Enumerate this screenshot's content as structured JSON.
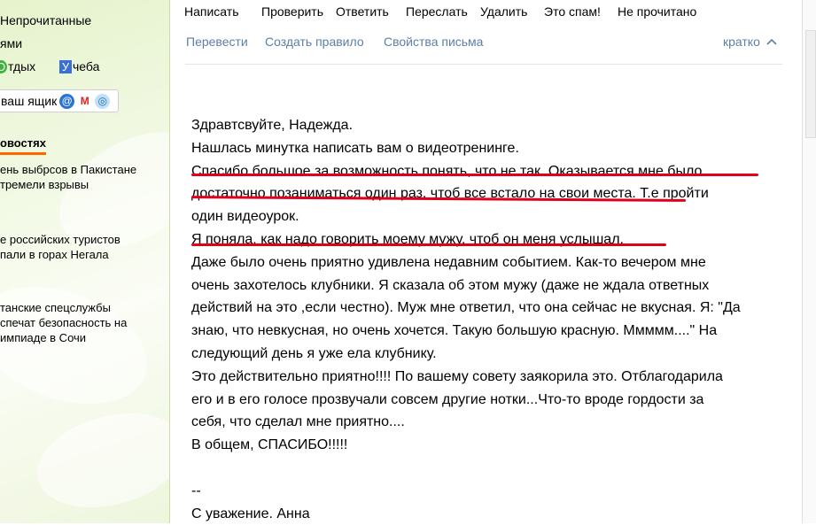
{
  "sidebar": {
    "unread_label": "Непрочитанные",
    "my_label": "ями",
    "tags": [
      {
        "label": "Отдых",
        "color": "#3cb43c"
      },
      {
        "label": "Учеба",
        "color": "#3a6fd8"
      }
    ],
    "mailbox_label": "ваш ящик",
    "news_heading": "овостях",
    "news_items": [
      {
        "line1": "ень выбрсов в Пакистане",
        "line2": "тремели взрывы"
      },
      {
        "line1": "е российских туристов",
        "line2": "пали в горах Негала"
      },
      {
        "line1": "танские спецслужбы",
        "line2": "спечат безопасность на",
        "line3": "импиаде в Сочи"
      }
    ]
  },
  "toolbar": {
    "buttons": [
      "Написать",
      "Проверить",
      "Ответить",
      "Переслать",
      "Удалить",
      "Это спам!",
      "Не прочитано"
    ]
  },
  "subbar": {
    "translate": "Перевести",
    "create_rule": "Создать правило",
    "properties": "Свойства письма",
    "brief": "кратко"
  },
  "message": {
    "lines": [
      "Здравтсвуйте, Надежда.",
      "Нашлась минутка написать вам о видеотренинге.",
      "Спасибо большое за возможность понять, что не так. Оказывается мне было",
      "достаточно позаниматься один раз, чтоб все встало на свои места. Т.е пройти",
      "один видеоурок.",
      "Я поняла, как надо говорить моему мужу, чтоб он меня услышал.",
      "Даже было очень приятно удивлена недавним событием. Как-то вечером мне",
      "очень захотелось клубники. Я сказала об этом мужу (даже не ждала ответных",
      "действий на это ,если честно). Муж мне ответил, что она сейчас не вкусная. Я: \"Да",
      "знаю, что невкусная, но очень хочется. Такую большую красную. Ммммм....\" На",
      "следующий день я уже ела клубнику.",
      "Это действительно приятно!!!! По вашему совету заякорила это. Отблагодарила",
      "его и в его голосе прозвучали совсем другие нотки...Что-то вроде гордости за",
      "себя, что сделал мне приятно....",
      "В общем, СПАСИБО!!!!!",
      "",
      "--",
      "С уважение. Анна"
    ]
  },
  "colors": {
    "underline": "#e0001b",
    "link": "#5b7fa8",
    "news_accent": "#ff6600"
  }
}
